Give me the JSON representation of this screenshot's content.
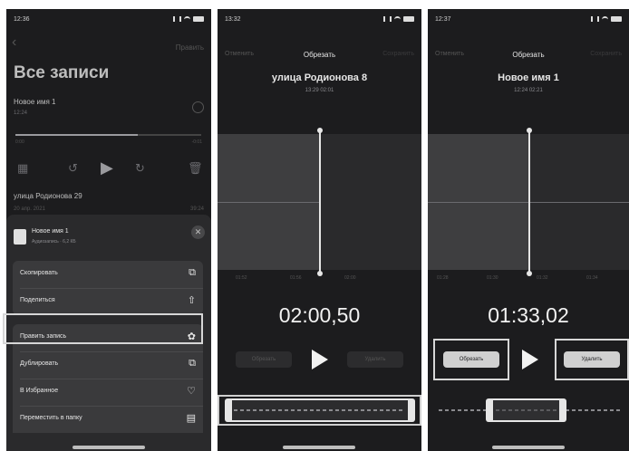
{
  "panel1": {
    "status_time": "12:36",
    "back_icon": "chevron-left",
    "edit_label": "Править",
    "title": "Все записи",
    "recording1": {
      "name": "Новое имя 1",
      "time": "12:24",
      "start": "0:00",
      "end": "-0:01"
    },
    "recording2": {
      "name": "улица Родионова 29",
      "date": "20 апр. 2021",
      "duration": "39:24"
    },
    "share_sheet": {
      "file_name": "Новое имя 1",
      "file_meta": "Аудиозапись · 6,2 КБ",
      "close_icon": "xmark",
      "menu": [
        {
          "label": "Скопировать",
          "icon": "copy-icon"
        },
        {
          "label": "Поделиться",
          "icon": "share-icon"
        },
        {
          "label": "Править запись",
          "icon": "waveform-icon"
        },
        {
          "label": "Дублировать",
          "icon": "duplicate-icon"
        },
        {
          "label": "В Избранное",
          "icon": "heart-icon"
        },
        {
          "label": "Переместить в папку",
          "icon": "folder-icon"
        }
      ]
    }
  },
  "panel2": {
    "status_time": "13:32",
    "cancel_label": "Отменить",
    "trim_label": "Обрезать",
    "save_label": "Сохранить",
    "track_name": "улица Родионова 8",
    "track_meta": "13:29  02:01",
    "time": "02:00,50",
    "trim_button": "Обрезать",
    "delete_button": "Удалить",
    "ticks": [
      "01:52",
      "01:56",
      "02:00"
    ]
  },
  "panel3": {
    "status_time": "12:37",
    "cancel_label": "Отменить",
    "trim_label": "Обрезать",
    "save_label": "Сохранить",
    "track_name": "Новое имя 1",
    "track_meta": "12:24  02:21",
    "time": "01:33,02",
    "trim_button": "Обрезать",
    "delete_button": "Удалить",
    "ticks": [
      "01:28",
      "01:30",
      "01:32",
      "01:34"
    ]
  }
}
